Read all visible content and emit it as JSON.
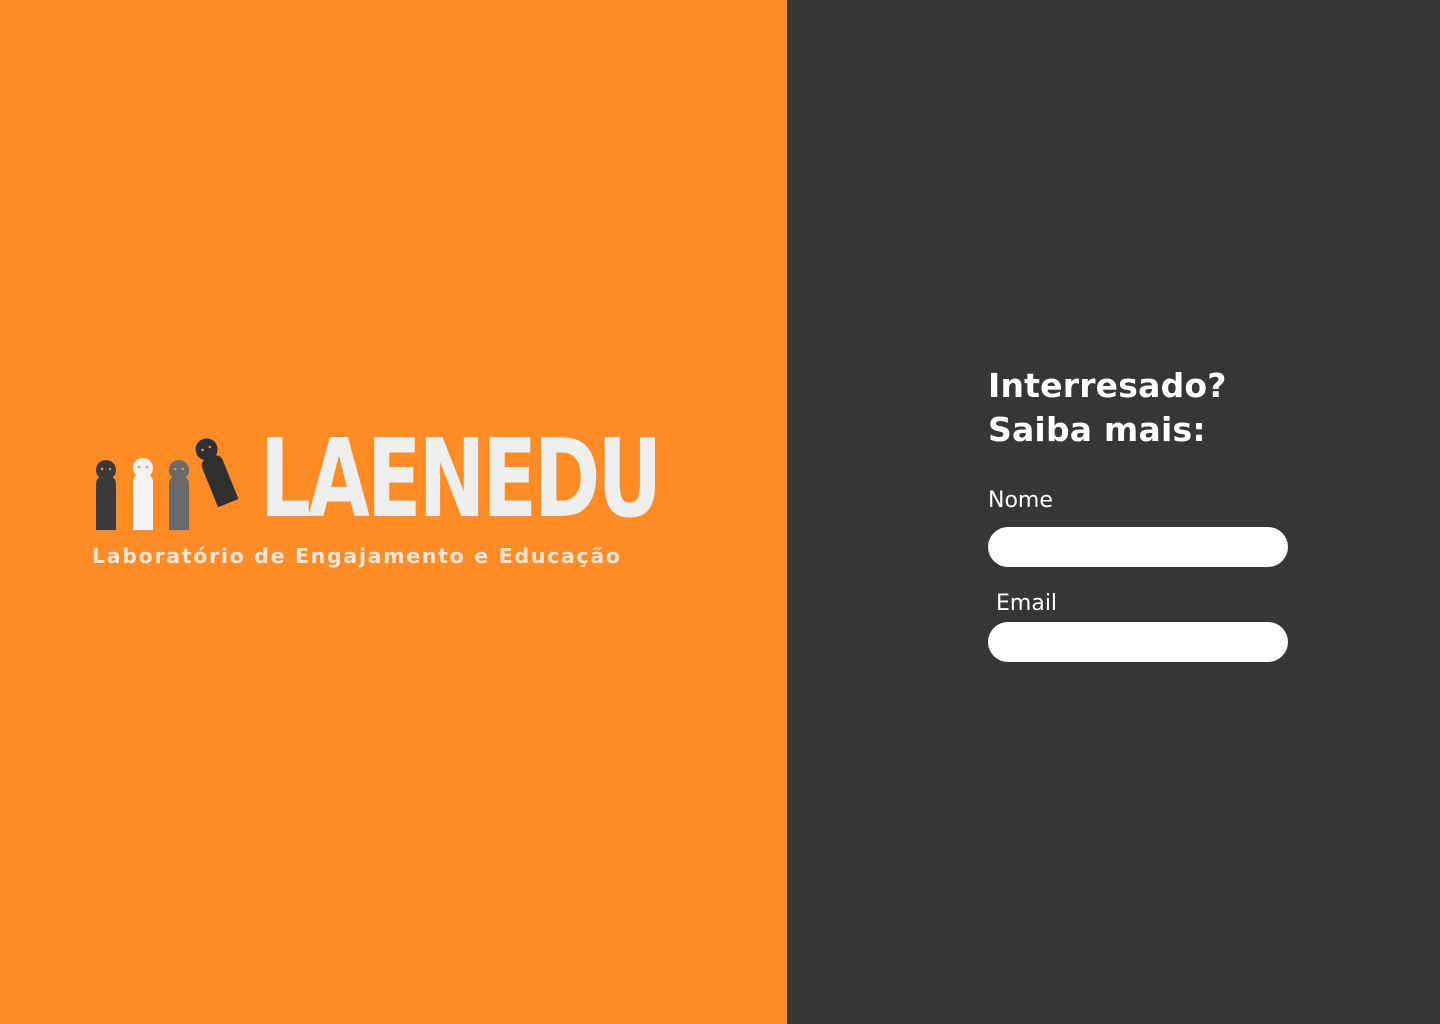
{
  "colors": {
    "left_background": "#ff8c27",
    "right_background": "#363636",
    "input_background": "#ffffff",
    "text_light": "#ffffff"
  },
  "logo": {
    "wordmark": "LAENEDU",
    "tagline": "Laboratório de Engajamento e Educação",
    "figures_icon": "people-figures-icon"
  },
  "form": {
    "title_line1": "Interresado?",
    "title_line2": "Saiba mais:",
    "name_label": "Nome",
    "name_value": "",
    "email_label": "Email",
    "email_value": ""
  }
}
